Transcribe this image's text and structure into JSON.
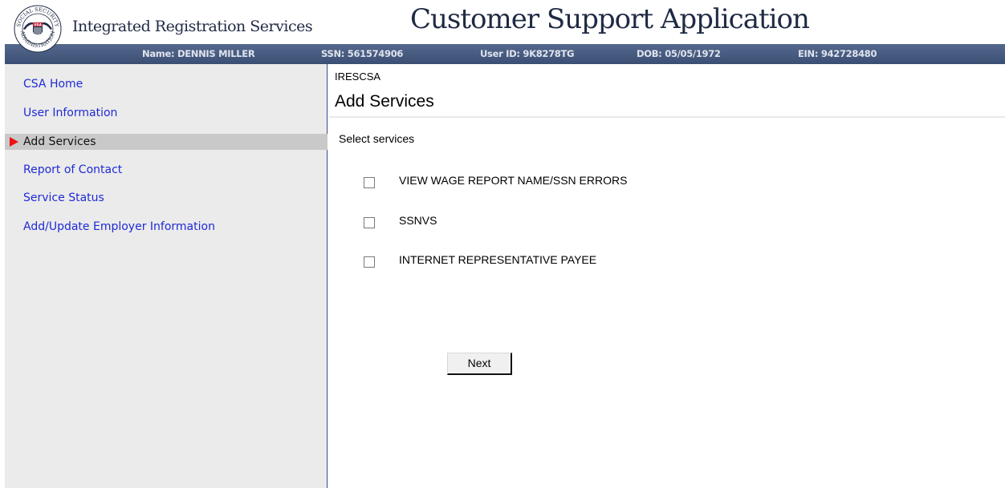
{
  "header": {
    "app_name": "Integrated Registration Services",
    "app_title": "Customer Support Application",
    "seal": {
      "top_text": "SOCIAL SECURITY",
      "bottom_text": "ADMINISTRATION",
      "center_text": "USA"
    }
  },
  "infobar": {
    "name": "Name: DENNIS MILLER",
    "ssn": "SSN: 561574906",
    "user_id": "User ID: 9K8278TG",
    "dob": "DOB: 05/05/1972",
    "ein": "EIN: 942728480"
  },
  "sidebar": {
    "items": [
      {
        "label": "CSA Home",
        "active": false
      },
      {
        "label": "User Information",
        "active": false
      },
      {
        "label": "Add Services",
        "active": true
      },
      {
        "label": "Report of Contact",
        "active": false
      },
      {
        "label": "Service Status",
        "active": false
      },
      {
        "label": "Add/Update Employer Information",
        "active": false
      }
    ]
  },
  "main": {
    "breadcrumb": "IRESCSA",
    "title": "Add Services",
    "section_label": "Select services",
    "services": [
      {
        "label": "VIEW WAGE REPORT NAME/SSN ERRORS",
        "checked": false
      },
      {
        "label": "SSNVS",
        "checked": false
      },
      {
        "label": "INTERNET REPRESENTATIVE PAYEE",
        "checked": false
      }
    ],
    "next_label": "Next"
  },
  "colors": {
    "infobar": "#3b4f74",
    "sidebar_bg": "#ebebeb",
    "nav_link": "#1f2ad6",
    "active_bg": "#c9c9c9",
    "active_arrow": "#ee1111",
    "title_text": "#1f2a44"
  }
}
